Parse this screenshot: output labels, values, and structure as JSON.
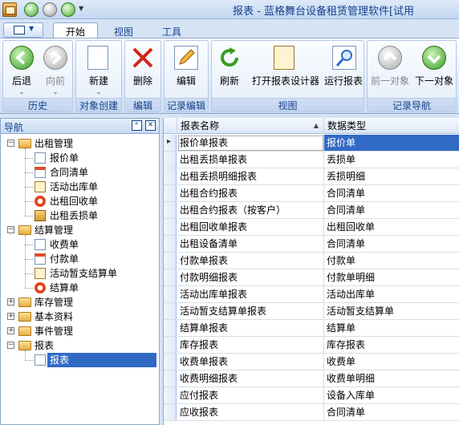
{
  "window": {
    "title": "报表 - 蓝格舞台设备租赁管理软件[试用"
  },
  "tabs": [
    {
      "label": "开始"
    },
    {
      "label": "视图"
    },
    {
      "label": "工具"
    }
  ],
  "ribbon": {
    "buttons": [
      {
        "label": "后退",
        "icon": "back-arrow-icon"
      },
      {
        "label": "向前",
        "icon": "forward-arrow-icon"
      },
      {
        "label": "新建",
        "icon": "new-document-icon"
      },
      {
        "label": "删除",
        "icon": "delete-x-icon"
      },
      {
        "label": "编辑",
        "icon": "edit-pencil-icon"
      },
      {
        "label": "刷新",
        "icon": "refresh-icon"
      },
      {
        "label": "打开报表设计器",
        "icon": "report-designer-icon"
      },
      {
        "label": "运行报表",
        "icon": "run-report-icon"
      },
      {
        "label": "前一对象",
        "icon": "previous-object-icon"
      },
      {
        "label": "下一对象",
        "icon": "next-object-icon"
      }
    ],
    "groups": [
      {
        "label": "历史"
      },
      {
        "label": "对象创建"
      },
      {
        "label": "编辑"
      },
      {
        "label": "记录编辑"
      },
      {
        "label": "视图"
      },
      {
        "label": "记录导航"
      }
    ]
  },
  "nav": {
    "title": "导航",
    "pin_symbol": "ᵖ",
    "close_symbol": "✕",
    "tree": [
      {
        "label": "出租管理",
        "expanded": true,
        "children": [
          "报价单",
          "合同清单",
          "活动出库单",
          "出租回收单",
          "出租丢损单"
        ]
      },
      {
        "label": "结算管理",
        "expanded": true,
        "children": [
          "收费单",
          "付款单",
          "活动暂支结算单",
          "结算单"
        ]
      },
      {
        "label": "库存管理",
        "expanded": false,
        "children": []
      },
      {
        "label": "基本资料",
        "expanded": false,
        "children": []
      },
      {
        "label": "事件管理",
        "expanded": false,
        "children": []
      },
      {
        "label": "报表",
        "expanded": true,
        "children": [
          "报表"
        ]
      }
    ]
  },
  "grid": {
    "columns": [
      {
        "label": "报表名称"
      },
      {
        "label": "数据类型"
      }
    ],
    "sort_indicator": "▲",
    "row_indicator": "▸",
    "rows": [
      [
        "报价单报表",
        "报价单"
      ],
      [
        "出租丢损单报表",
        "丢损单"
      ],
      [
        "出租丢损明细报表",
        "丢损明细"
      ],
      [
        "出租合约报表",
        "合同清单"
      ],
      [
        "出租合约报表（按客户）",
        "合同清单"
      ],
      [
        "出租回收单报表",
        "出租回收单"
      ],
      [
        "出租设备清单",
        "合同清单"
      ],
      [
        "付款单报表",
        "付款单"
      ],
      [
        "付款明细报表",
        "付款单明细"
      ],
      [
        "活动出库单报表",
        "活动出库单"
      ],
      [
        "活动暂支结算单报表",
        "活动暂支结算单"
      ],
      [
        "结算单报表",
        "结算单"
      ],
      [
        "库存报表",
        "库存报表"
      ],
      [
        "收费单报表",
        "收费单"
      ],
      [
        "收费明细报表",
        "收费单明细"
      ],
      [
        "应付报表",
        "设备入库单"
      ],
      [
        "应收报表",
        "合同清单"
      ]
    ]
  }
}
